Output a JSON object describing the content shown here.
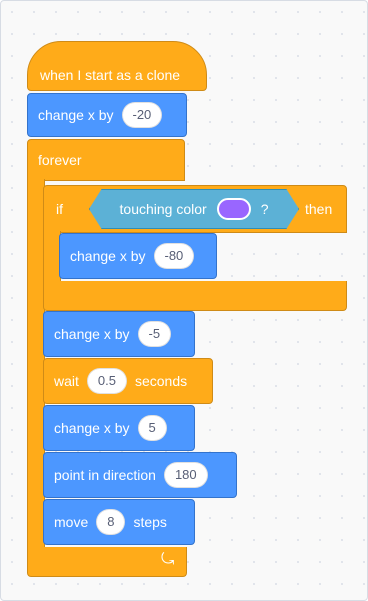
{
  "script": {
    "hat_label": "when I start as a clone",
    "change_x_1": {
      "label": "change x by",
      "value": "-20"
    },
    "forever_label": "forever",
    "if_block": {
      "if_label": "if",
      "condition_label": "touching color",
      "condition_suffix": "?",
      "then_label": "then",
      "swatch_color": "#9966ff"
    },
    "change_x_inner": {
      "label": "change x by",
      "value": "-80"
    },
    "change_x_2": {
      "label": "change x by",
      "value": "-5"
    },
    "wait_block": {
      "label": "wait",
      "value": "0.5",
      "suffix": "seconds"
    },
    "change_x_3": {
      "label": "change x by",
      "value": "5"
    },
    "point_block": {
      "label": "point in direction",
      "value": "180"
    },
    "move_block": {
      "label": "move",
      "value": "8",
      "suffix": "steps"
    },
    "loop_arrow_icon": "loop-arrow-icon"
  },
  "colors": {
    "control": "#ffab19",
    "motion": "#4c97ff",
    "sensing": "#5cb1d6",
    "swatch": "#9966ff"
  }
}
